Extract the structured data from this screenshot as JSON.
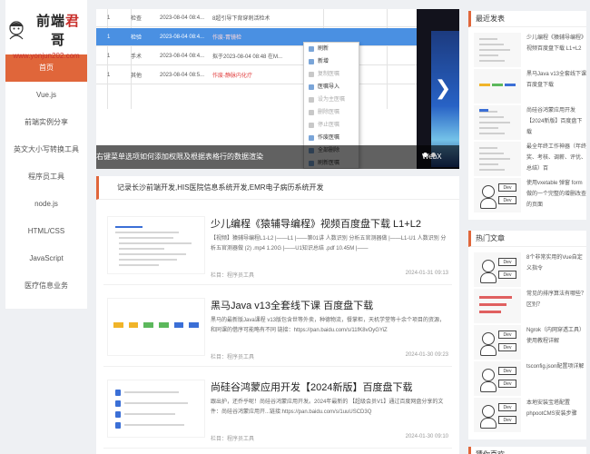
{
  "logo": {
    "title_a": "前端",
    "title_b": "君",
    "title_c": "哥",
    "url": "www.yonjun202.com"
  },
  "nav": {
    "items": [
      "首页",
      "Vue.js",
      "前端实例分享",
      "英文大小写转换工具",
      "程序员工具",
      "node.js",
      "HTML/CSS",
      "JavaScript",
      "医疗信息业务"
    ],
    "active_index": 0
  },
  "carousel": {
    "caption": "右键菜单选项如何添加权限及根据表格行的数据渲染",
    "next_caption": "WebX",
    "rows": [
      {
        "no": "1",
        "type": "检查",
        "time": "2023-08-04 08:4...",
        "text": "8超引导下背穿刺活检术",
        "red": false
      },
      {
        "no": "1",
        "type": "检验",
        "time": "2023-08-04 08:4...",
        "text": "作废-胃镜检",
        "red": true
      },
      {
        "no": "1",
        "type": "手术",
        "time": "2023-08-04 08:4...",
        "text": "拟于2023-08-04 08:48 在M...",
        "red": false
      },
      {
        "no": "1",
        "type": "其他",
        "time": "2023-08-04 08:5...",
        "text": "作废-静脉内化疗",
        "red": true
      }
    ],
    "context_menu": [
      {
        "label": "刷新",
        "disabled": false
      },
      {
        "label": "新增",
        "disabled": false
      },
      {
        "label": "复制医嘱",
        "disabled": true
      },
      {
        "label": "医嘱导入",
        "disabled": false
      },
      {
        "label": "设为主医嘱",
        "disabled": true
      },
      {
        "label": "删除医嘱",
        "disabled": true
      },
      {
        "label": "停止医嘱",
        "disabled": true
      },
      {
        "label": "作废医嘱",
        "disabled": false
      },
      {
        "label": "全部删除",
        "disabled": false
      },
      {
        "label": "刷新医嘱",
        "disabled": false
      }
    ]
  },
  "announce": "记录长沙前端开发,HIS医院信息系统开发,EMR电子病历系统开发",
  "articles": [
    {
      "title": "少儿编程《猿辅导编程》视频百度盘下载 L1+L2",
      "summary": "【视频】猿辅导编程L1-L2 |——L1 |——第01讲 人数识别 分析五官测器做 |——L1-U1 人数识别 分析五官测器做 (2) .mp4 1.20G |——U1知识总结 .pdf 10.45M |——",
      "category": "栏目：程序员工具",
      "date": "2024-01-31 09:13"
    },
    {
      "title": "黑马Java v13全套线下课 百度盘下载",
      "summary": "黑马的最新版Java课程 v13版包含世等外卖，种德物流，餐掌柜，天机学堂等十余个项目的资源，和同课的借序可能略有不同 链接：https://pan.baidu.com/s/11fK8vOyGYiZ",
      "category": "栏目：程序员工具",
      "date": "2024-01-30 09:23"
    },
    {
      "title": "尚硅谷鸿蒙应用开发【2024新版】百度盘下载",
      "summary": "跟出护，还乔乎呢！尚硅谷鸿蒙应用开发。2024年最新的 【超级会员V1】通过百度网盘分享的文件：尚硅谷鸿蒙应用开...链接:https://pan.baidu.com/s/1uuUSCD3Q",
      "category": "栏目：程序员工具",
      "date": "2024-01-30 09:10"
    }
  ],
  "sidebar": {
    "recent_title": "最近发表",
    "recent": [
      "少儿编程《猿辅导编程》视频百度盘下载 L1+L2",
      "黑马Java v13全套线下课 百度盘下载",
      "尚硅谷鸿蒙应用开发【2024新版】百度盘下载",
      "最全年终工作神器（年终奖、考核、调薪、评优、总结）百",
      "使用vxetable 弹窗 form 做的一个完整的增删改查的页面"
    ],
    "hot_title": "热门文章",
    "hot": [
      "8个非常实用的Vue自定义指令",
      "常见的排序算法有哪些？区别？",
      "Ngrok（内网穿透工具）使用教程详解",
      "tsconfig.json配置项详解",
      "本地安装宝塔配置phpootCMS安装步骤"
    ],
    "more_title": "猜你喜欢"
  }
}
